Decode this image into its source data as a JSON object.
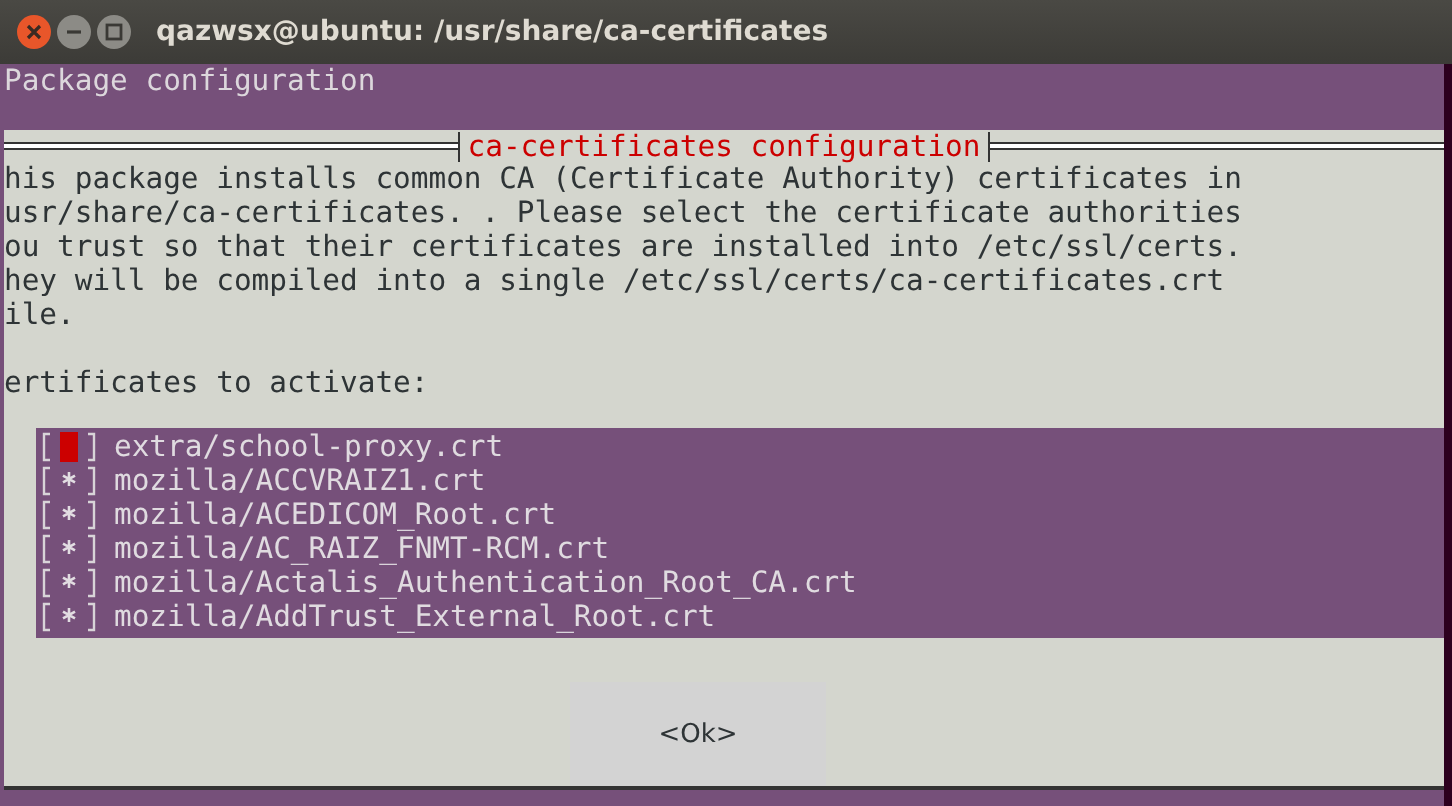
{
  "window": {
    "title": "qazwsx@ubuntu: /usr/share/ca-certificates"
  },
  "terminal": {
    "header": "Package configuration"
  },
  "dialog": {
    "title": "ca-certificates configuration",
    "description": [
      "his package installs common CA (Certificate Authority) certificates in",
      "usr/share/ca-certificates. . Please select the certificate authorities",
      "ou trust so that their certificates are installed into /etc/ssl/certs.",
      "hey will be compiled into a single /etc/ssl/certs/ca-certificates.crt",
      "ile."
    ],
    "prompt": "ertificates to activate:",
    "items": [
      {
        "label": "extra/school-proxy.crt",
        "checked": false,
        "selected": true
      },
      {
        "label": "mozilla/ACCVRAIZ1.crt",
        "checked": true,
        "selected": false
      },
      {
        "label": "mozilla/ACEDICOM_Root.crt",
        "checked": true,
        "selected": false
      },
      {
        "label": "mozilla/AC_RAIZ_FNMT-RCM.crt",
        "checked": true,
        "selected": false
      },
      {
        "label": "mozilla/Actalis_Authentication_Root_CA.crt",
        "checked": true,
        "selected": false
      },
      {
        "label": "mozilla/AddTrust_External_Root.crt",
        "checked": true,
        "selected": false
      }
    ],
    "buttons": [
      {
        "label": "<Ok>"
      }
    ]
  }
}
